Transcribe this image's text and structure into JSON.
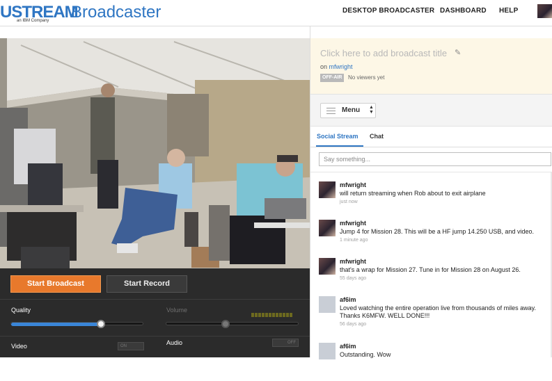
{
  "header": {
    "logo_main": "USTREAM",
    "logo_product": "Broadcaster",
    "logo_tagline": "an IBM Company",
    "nav": [
      "DESKTOP BROADCASTER",
      "DASHBOARD",
      "HELP"
    ]
  },
  "controls": {
    "start_broadcast": "Start Broadcast",
    "start_record": "Start Record",
    "quality_label": "Quality",
    "quality_level": 0.68,
    "volume_label": "Volume",
    "volume_level": 0.45,
    "video_label": "Video",
    "audio_label": "Audio",
    "video_toggle": "ON",
    "audio_toggle": "OFF"
  },
  "broadcast": {
    "title_placeholder": "Click here to add broadcast title",
    "on_prefix": "on",
    "channel": "mfwright",
    "status_badge": "OFF-AIR",
    "viewers": "No viewers yet"
  },
  "menu": {
    "label": "Menu"
  },
  "tabs": [
    "Social Stream",
    "Chat"
  ],
  "stream": {
    "input_placeholder": "Say something...",
    "messages": [
      {
        "user": "mfwright",
        "text": "will return streaming when Rob about to exit airplane",
        "time": "just now",
        "avatar": "pic"
      },
      {
        "user": "mfwright",
        "text": "Jump 4 for Mission 28. This will be a HF jump 14.250 USB, and video.",
        "time": "1 minute ago",
        "avatar": "pic"
      },
      {
        "user": "mfwright",
        "text": "that's a wrap for Mission 27. Tune in for Mission 28 on August 26.",
        "time": "55 days ago",
        "avatar": "pic"
      },
      {
        "user": "af6im",
        "text": "Loved watching the entire operation live from thousands of miles away. Thanks K6MFW. WELL DONE!!!",
        "time": "56 days ago",
        "avatar": "blank"
      },
      {
        "user": "af6im",
        "text": "Outstanding. Wow",
        "time": "",
        "avatar": "blank"
      }
    ]
  },
  "colors": {
    "brand_blue": "#2f76c3",
    "broadcast_orange": "#e8792c",
    "title_bg": "#fdf7e6"
  }
}
